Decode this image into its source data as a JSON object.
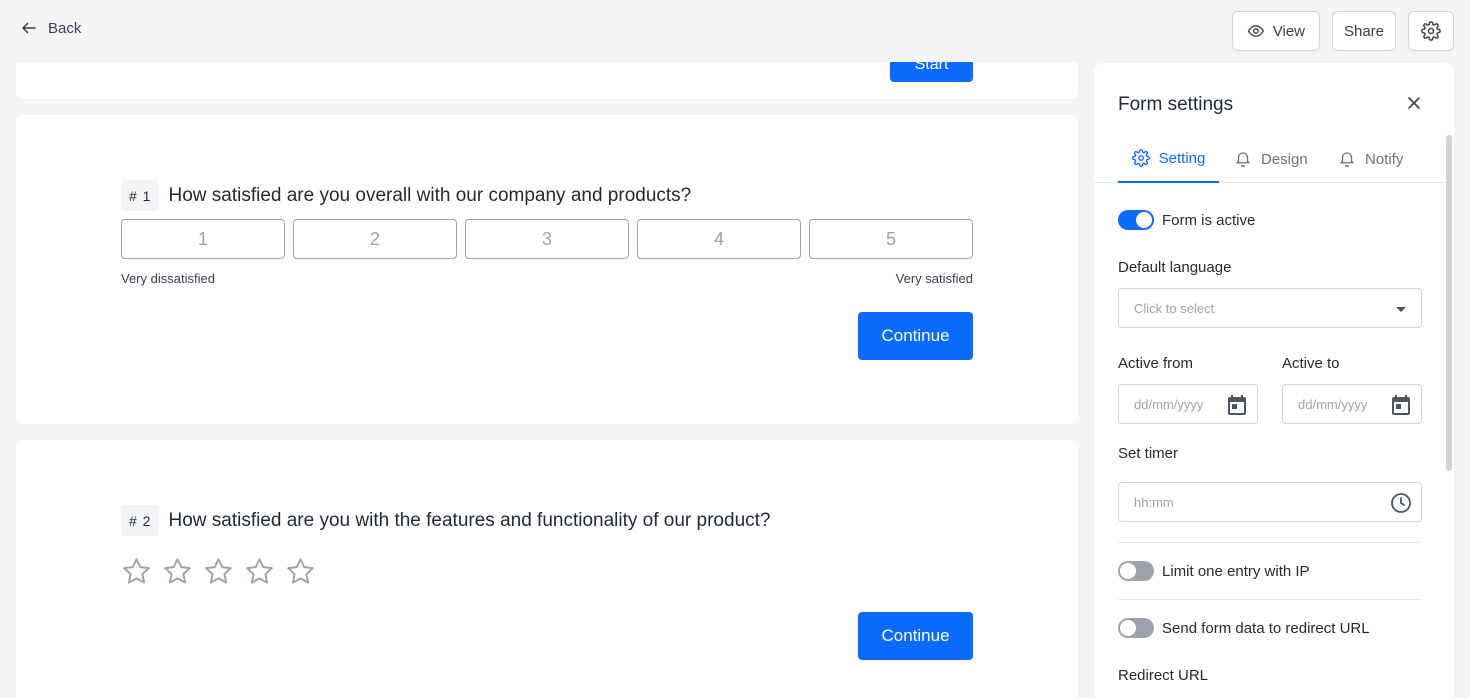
{
  "topbar": {
    "back_label": "Back",
    "view_label": "View",
    "share_label": "Share"
  },
  "intro": {
    "start_label": "Start"
  },
  "questions": [
    {
      "number": "# 1",
      "text": "How satisfied are you overall with our company and products?",
      "scale": [
        "1",
        "2",
        "3",
        "4",
        "5"
      ],
      "min_label": "Very dissatisfied",
      "max_label": "Very satisfied",
      "continue_label": "Continue"
    },
    {
      "number": "# 2",
      "text": "How satisfied are you with the features and functionality of our product?",
      "stars": 5,
      "continue_label": "Continue"
    }
  ],
  "panel": {
    "title": "Form settings",
    "tabs": [
      {
        "label": "Setting",
        "icon": "gear-icon",
        "active": true
      },
      {
        "label": "Design",
        "icon": "bell-icon",
        "active": false
      },
      {
        "label": "Notify",
        "icon": "bell-icon",
        "active": false
      }
    ],
    "form_active_label": "Form is active",
    "form_active": true,
    "default_language_label": "Default language",
    "default_language_placeholder": "Click to select",
    "active_from_label": "Active from",
    "active_from_placeholder": "dd/mm/yyyy",
    "active_to_label": "Active to",
    "active_to_placeholder": "dd/mm/yyyy",
    "set_timer_label": "Set timer",
    "set_timer_placeholder": "hh:mm",
    "limit_ip_label": "Limit one entry with IP",
    "limit_ip": false,
    "redirect_data_label": "Send form data to redirect URL",
    "redirect_data": false,
    "redirect_url_label": "Redirect URL"
  },
  "colors": {
    "accent": "#0b6bff",
    "background": "#f3f4f6",
    "border": "#d1d5db"
  }
}
